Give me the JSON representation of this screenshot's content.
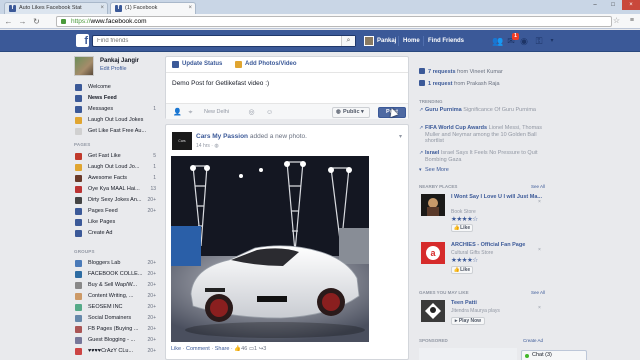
{
  "browser": {
    "tabs": [
      {
        "title": "Auto Likes Facebook Stat"
      },
      {
        "title": "(1) Facebook"
      }
    ],
    "url_scheme": "https://",
    "url_host": "www.facebook.com"
  },
  "fb_header": {
    "search_placeholder": "Find friends",
    "user_name": "Pankaj",
    "nav": [
      "Home",
      "Find Friends"
    ],
    "notification_count": "1"
  },
  "profile": {
    "name": "Pankaj Jangir",
    "edit": "Edit Profile"
  },
  "left_nav": {
    "main": [
      {
        "label": "Welcome",
        "count": "",
        "icon_color": "#3b5998"
      },
      {
        "label": "News Feed",
        "count": "",
        "icon_color": "#3b5998"
      },
      {
        "label": "Messages",
        "count": "1",
        "icon_color": "#3b5998"
      },
      {
        "label": "Laugh Out Loud Jokes",
        "count": "",
        "icon_color": "#e0a530"
      },
      {
        "label": "Get Like Fast Free Au...",
        "count": "",
        "icon_color": "#d0d0d0"
      }
    ],
    "pages_heading": "PAGES",
    "pages": [
      {
        "label": "Get Fast Like",
        "count": "5",
        "icon_color": "#c0392b"
      },
      {
        "label": "Laugh Out Loud Jo...",
        "count": "1",
        "icon_color": "#e0a530"
      },
      {
        "label": "Awesome Facts",
        "count": "1",
        "icon_color": "#6a3a2a"
      },
      {
        "label": "Oye Kya MAAL Hai...",
        "count": "13",
        "icon_color": "#b33"
      },
      {
        "label": "Dirty Sexy Jokes An...",
        "count": "20+",
        "icon_color": "#444"
      },
      {
        "label": "Pages Feed",
        "count": "20+",
        "icon_color": "#3b5998"
      },
      {
        "label": "Like Pages",
        "count": "",
        "icon_color": "#3b5998"
      },
      {
        "label": "Create Ad",
        "count": "",
        "icon_color": "#3b5998"
      }
    ],
    "groups_heading": "GROUPS",
    "groups": [
      {
        "label": "Bloggers Lab",
        "count": "20+",
        "icon_color": "#4a7ab8"
      },
      {
        "label": "FACEBOOK COLLE...",
        "count": "20+",
        "icon_color": "#2d6ca2"
      },
      {
        "label": "Buy & Sell Wap/W...",
        "count": "20+",
        "icon_color": "#888"
      },
      {
        "label": "Content Writing, ...",
        "count": "20+",
        "icon_color": "#c96"
      },
      {
        "label": "SEOSEM INC",
        "count": "20+",
        "icon_color": "#5a8"
      },
      {
        "label": "Social Domainers",
        "count": "20+",
        "icon_color": "#68a"
      },
      {
        "label": "FB Pages (Buying ...",
        "count": "20+",
        "icon_color": "#a55"
      },
      {
        "label": "Guest Blogging - ...",
        "count": "20+",
        "icon_color": "#779"
      },
      {
        "label": "♥♥♥♥CrAzY CLu...",
        "count": "20+",
        "icon_color": "#c44"
      }
    ]
  },
  "composer": {
    "tab_status": "Update Status",
    "tab_photo": "Add Photos/Video",
    "text": "Demo Post for Getlikefast video :)",
    "location": "New Delhi",
    "privacy": "Public",
    "post": "Post"
  },
  "story": {
    "page_name": "Cars My Passion",
    "action_text": "added a new photo.",
    "time": "14 hrs",
    "page_pic_text": "Cars Passion",
    "footer": {
      "like": "Like",
      "comment": "Comment",
      "share": "Share",
      "likes": "46",
      "comments": "1",
      "shares": "3"
    }
  },
  "right_col": {
    "friend_requests": {
      "count_text": "7 requests",
      "from": "from Vineet Kumar"
    },
    "page_requests": {
      "count_text": "1 request",
      "from": "from Prakash Raja"
    },
    "trending_heading": "TRENDING",
    "trending": [
      {
        "topic": "Guru Purnima",
        "desc": "Significance Of Guru Purnima"
      },
      {
        "topic": "FIFA World Cup Awards",
        "desc": "Lionel Messi, Thomas Muller and Neymar among the 10 Golden Ball shortlist"
      },
      {
        "topic": "Israel",
        "desc": "Israel Says It Feels No Pressure to Quit Bombing Gaza"
      }
    ],
    "see_more": "See More",
    "nearby_heading": "NEARBY PLACES",
    "see_all": "See All",
    "places": [
      {
        "name": "I Wont Say I Love U I will Just Ma...",
        "category": "Book Store",
        "stars": "★★★★☆",
        "like": "Like"
      },
      {
        "name": "ARCHIES - Official Fan Page",
        "category": "Cultural Gifts Store",
        "stars": "★★★★☆",
        "like": "Like"
      }
    ],
    "games_heading": "GAMES YOU MAY LIKE",
    "games": [
      {
        "name": "Teen Patti",
        "players": "Jitendra Maurya plays",
        "play": "Play Now"
      }
    ],
    "sponsored": "SPONSORED",
    "create_ad": "Create Ad"
  },
  "chat": {
    "label": "Chat (3)"
  }
}
